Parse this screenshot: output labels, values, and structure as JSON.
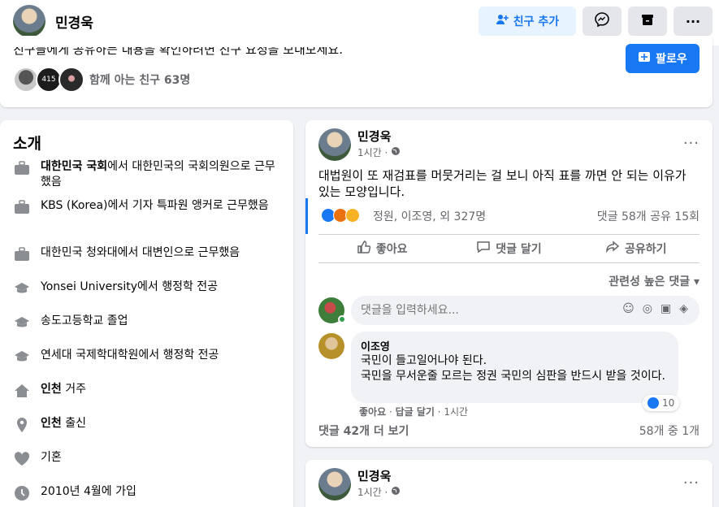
{
  "header": {
    "name": "민경욱",
    "add_friend": "친구 추가",
    "messenger_icon": "messenger-icon",
    "save_icon": "save-icon",
    "more": "···"
  },
  "intro": {
    "notice": "친구들에게 공유하는 내용을 확인하려면 친구 요청을 보내보세요.",
    "mutual": "함께 아는 친구 63명",
    "mutual_badge": "415",
    "follow": "팔로우"
  },
  "about": {
    "title": "소개",
    "items": [
      {
        "icon": "work-icon",
        "bold": "대한민국 국회",
        "text": "에서 대한민국의 국회의원으로 근무했음"
      },
      {
        "icon": "work-icon",
        "bold": "",
        "text": "KBS (Korea)에서 기자 특파원 앵커로 근무했음"
      },
      {
        "icon": "work-icon",
        "bold": "",
        "text": "대한민국 청와대에서 대변인으로 근무했음"
      },
      {
        "icon": "education-icon",
        "bold": "",
        "text": "Yonsei University에서 행정학 전공"
      },
      {
        "icon": "education-icon",
        "bold": "",
        "text": "송도고등학교 졸업"
      },
      {
        "icon": "education-icon",
        "bold": "",
        "text": "연세대 국제학대학원에서 행정학 전공"
      },
      {
        "icon": "home-icon",
        "bold": "인천",
        "text": " 거주"
      },
      {
        "icon": "location-icon",
        "bold": "인천",
        "text": " 출신"
      },
      {
        "icon": "heart-icon",
        "bold": "",
        "text": "기혼"
      },
      {
        "icon": "clock-icon",
        "bold": "",
        "text": "2010년 4월에 가입"
      }
    ]
  },
  "post1": {
    "author": "민경욱",
    "time": "1시간 ·",
    "text": "대법원이 또 재검표를 머뭇거리는 걸 보니 아직 표를 까면 안 되는 이유가 있는 모양입니다.",
    "reactors": "정원, 이조영, 외 327명",
    "counts": "댓글 58개  공유 15회",
    "actions": {
      "like": "좋아요",
      "comment": "댓글 달기",
      "share": "공유하기"
    },
    "sort": "관련성 높은 댓글 ▾",
    "comment_placeholder": "댓글을 입력하세요...",
    "comment": {
      "author": "이조영",
      "lines": [
        "국민이 들고일어나야 된다.",
        "국민을 무서운줄 모르는 정권 국민의 심판을 반드시 받을 것이다."
      ],
      "likes": "10",
      "like_label": "좋아요",
      "reply_label": "답글 달기",
      "time": "1시간"
    },
    "more_comments": "댓글 42개 더 보기",
    "comment_count": "58개 중 1개"
  },
  "post2": {
    "author": "민경욱",
    "time": "1시간 ·"
  }
}
